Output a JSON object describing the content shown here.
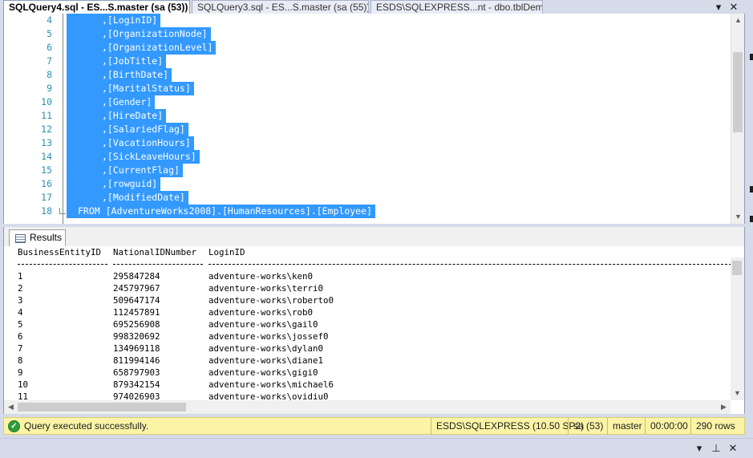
{
  "tabs": [
    {
      "label": "SQLQuery4.sql - ES...S.master (sa (53))",
      "active": true
    },
    {
      "label": "SQLQuery3.sql - ES...S.master (sa (55))*",
      "active": false
    },
    {
      "label": "ESDS\\SQLEXPRESS...nt - dbo.tblDemo",
      "active": false
    }
  ],
  "tab_controls": {
    "dropdown": "▾",
    "close": "✕"
  },
  "editor": {
    "lines": [
      {
        "num": "4",
        "text": ",[LoginID]"
      },
      {
        "num": "5",
        "text": ",[OrganizationNode]"
      },
      {
        "num": "6",
        "text": ",[OrganizationLevel]"
      },
      {
        "num": "7",
        "text": ",[JobTitle]"
      },
      {
        "num": "8",
        "text": ",[BirthDate]"
      },
      {
        "num": "9",
        "text": ",[MaritalStatus]"
      },
      {
        "num": "10",
        "text": ",[Gender]"
      },
      {
        "num": "11",
        "text": ",[HireDate]"
      },
      {
        "num": "12",
        "text": ",[SalariedFlag]"
      },
      {
        "num": "13",
        "text": ",[VacationHours]"
      },
      {
        "num": "14",
        "text": ",[SickLeaveHours]"
      },
      {
        "num": "15",
        "text": ",[CurrentFlag]"
      },
      {
        "num": "16",
        "text": ",[rowguid]"
      },
      {
        "num": "17",
        "text": ",[ModifiedDate]"
      },
      {
        "num": "18",
        "text": "FROM [AdventureWorks2008].[HumanResources].[Employee]"
      }
    ]
  },
  "results": {
    "tab_label": "Results",
    "columns": [
      "BusinessEntityID",
      "NationalIDNumber",
      "LoginID"
    ],
    "rows": [
      [
        "1",
        "295847284",
        "adventure-works\\ken0"
      ],
      [
        "2",
        "245797967",
        "adventure-works\\terri0"
      ],
      [
        "3",
        "509647174",
        "adventure-works\\roberto0"
      ],
      [
        "4",
        "112457891",
        "adventure-works\\rob0"
      ],
      [
        "5",
        "695256908",
        "adventure-works\\gail0"
      ],
      [
        "6",
        "998320692",
        "adventure-works\\jossef0"
      ],
      [
        "7",
        "134969118",
        "adventure-works\\dylan0"
      ],
      [
        "8",
        "811994146",
        "adventure-works\\diane1"
      ],
      [
        "9",
        "658797903",
        "adventure-works\\gigi0"
      ],
      [
        "10",
        "879342154",
        "adventure-works\\michael6"
      ],
      [
        "11",
        "974026903",
        "adventure-works\\ovidiu0"
      ]
    ]
  },
  "status": {
    "message": "Query executed successfully.",
    "server": "ESDS\\SQLEXPRESS (10.50 SP2)",
    "user": "sa (53)",
    "database": "master",
    "elapsed": "00:00:00",
    "rows": "290 rows"
  },
  "bottom_controls": {
    "dropdown": "▾",
    "pin": "⊥",
    "close": "✕"
  },
  "colors": {
    "selection": "#3399ff",
    "line_numbers": "#2b91af",
    "status_bar": "#fbf4a6",
    "chrome": "#d6dbe9"
  }
}
